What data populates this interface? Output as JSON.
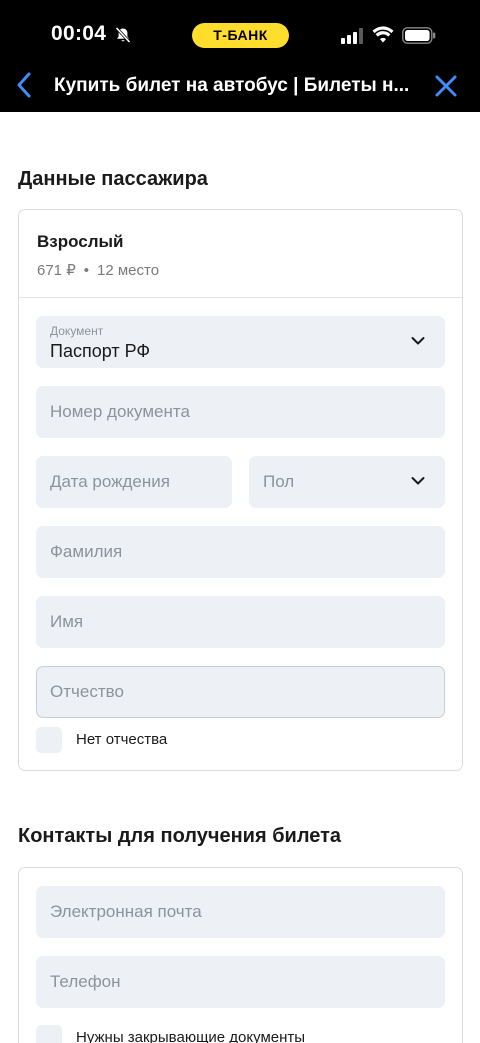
{
  "status_bar": {
    "time": "00:04",
    "bank_badge": "Т-БАНК",
    "icons": [
      "bell-slash-icon",
      "signal-icon",
      "wifi-icon",
      "battery-icon"
    ]
  },
  "nav": {
    "title": "Купить билет на автобус | Билеты н...",
    "back_icon": "chevron-left-icon",
    "close_icon": "close-icon",
    "accent_color": "#428bf9"
  },
  "passenger_section": {
    "title": "Данные пассажира",
    "passenger": {
      "type": "Взрослый",
      "price": "671 ₽",
      "separator": "•",
      "seat": "12 место"
    },
    "document": {
      "label": "Документ",
      "value": "Паспорт РФ"
    },
    "fields": {
      "doc_number_placeholder": "Номер документа",
      "birth_date_placeholder": "Дата рождения",
      "gender_placeholder": "Пол",
      "last_name_placeholder": "Фамилия",
      "first_name_placeholder": "Имя",
      "middle_name_placeholder": "Отчество"
    },
    "no_middle_name_label": "Нет отчества",
    "no_middle_name_checked": false
  },
  "contacts_section": {
    "title": "Контакты для получения билета",
    "email_placeholder": "Электронная почта",
    "phone_placeholder": "Телефон",
    "closing_docs_label": "Нужны закрывающие документы",
    "closing_docs_checked": false
  },
  "colors": {
    "status_bar_bg": "#000000",
    "badge_bg": "#ffdd2d",
    "field_bg": "#edf0f5",
    "placeholder": "#8d939c"
  }
}
